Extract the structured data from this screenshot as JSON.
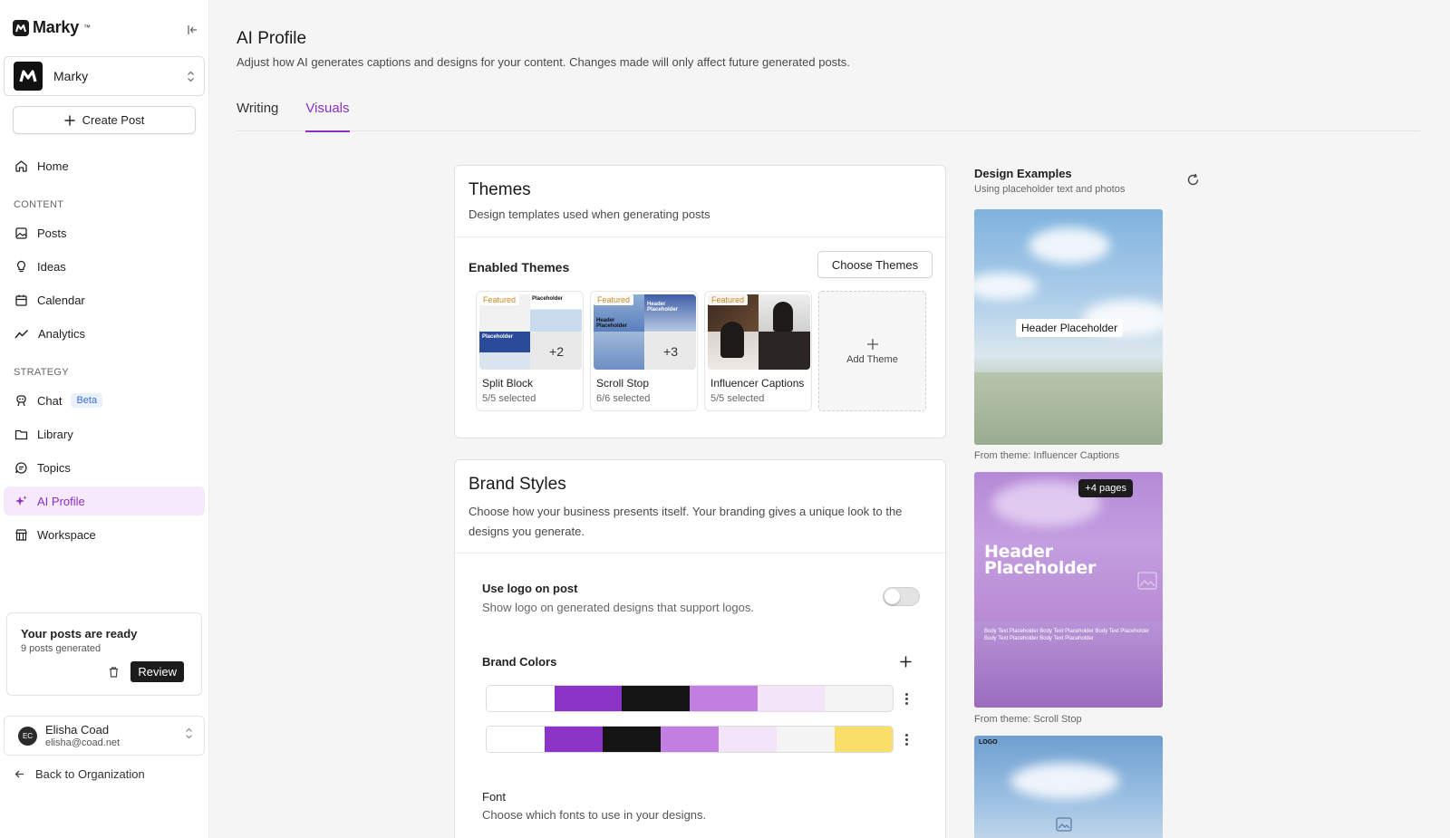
{
  "app": {
    "brand_name": "Marky",
    "brand_tm": "™"
  },
  "workspace": {
    "name": "Marky"
  },
  "sidebar": {
    "create_label": "Create Post",
    "home_label": "Home",
    "content_section": "CONTENT",
    "strategy_section": "STRATEGY",
    "items": {
      "posts": "Posts",
      "ideas": "Ideas",
      "calendar": "Calendar",
      "analytics": "Analytics",
      "chat": "Chat",
      "chat_badge": "Beta",
      "library": "Library",
      "topics": "Topics",
      "ai_profile": "AI Profile",
      "workspace": "Workspace"
    },
    "notice": {
      "title": "Your posts are ready",
      "subtitle": "9 posts generated",
      "review_label": "Review"
    },
    "user": {
      "initials": "EC",
      "name": "Elisha Coad",
      "email": "elisha@coad.net"
    },
    "back_label": "Back to Organization"
  },
  "page": {
    "title": "AI Profile",
    "subtitle": "Adjust how AI generates captions and designs for your content. Changes made will only affect future generated posts.",
    "tabs": [
      "Writing",
      "Visuals"
    ],
    "active_tab": "Visuals"
  },
  "themes": {
    "title": "Themes",
    "description": "Design templates used when generating posts",
    "enabled_title": "Enabled Themes",
    "choose_label": "Choose Themes",
    "featured_label": "Featured",
    "items": [
      {
        "name": "Split Block",
        "selected": "5/5 selected",
        "more": "+2"
      },
      {
        "name": "Scroll Stop",
        "selected": "6/6 selected",
        "more": "+3"
      },
      {
        "name": "Influencer Captions",
        "selected": "5/5 selected",
        "more": ""
      }
    ],
    "add_label": "Add Theme"
  },
  "brand": {
    "title": "Brand Styles",
    "description": "Choose how your business presents itself. Your branding gives a unique look to the designs you generate.",
    "logo_label": "Use logo on post",
    "logo_sub": "Show logo on generated designs that support logos.",
    "logo_enabled": false,
    "colors_label": "Brand Colors",
    "palettes": [
      [
        "#ffffff",
        "#8c34c8",
        "#141414",
        "#c27ee0",
        "#f3e4f9",
        "#f4f4f4"
      ],
      [
        "#ffffff",
        "#8c34c8",
        "#141414",
        "#c27ee0",
        "#f3e4f9",
        "#f4f4f4",
        "#f7df6a"
      ]
    ],
    "font_label": "Font",
    "font_sub": "Choose which fonts to use in your designs."
  },
  "examples": {
    "title": "Design Examples",
    "subtitle": "Using placeholder text and photos",
    "items": [
      {
        "header": "Header Placeholder",
        "caption": "From theme: Influencer Captions"
      },
      {
        "badge": "+4 pages",
        "header": "Header Placeholder",
        "body": "Body Text Placeholder Body Text Placeholder Body Text Placeholder Body Text Placeholder Body Text Placeholder",
        "caption": "From theme: Scroll Stop"
      },
      {
        "logo": "LOGO"
      }
    ]
  }
}
